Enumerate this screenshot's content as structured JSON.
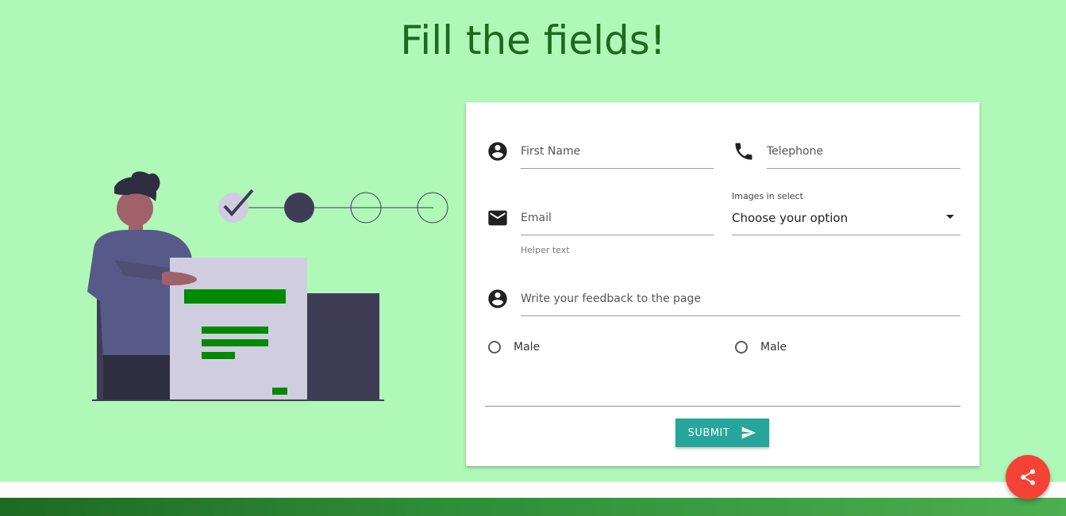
{
  "page": {
    "title": "Fill the fields!"
  },
  "form": {
    "first_name": {
      "placeholder": "First Name",
      "value": ""
    },
    "telephone": {
      "placeholder": "Telephone",
      "value": ""
    },
    "email": {
      "placeholder": "Email",
      "value": "",
      "helper": "Helper text"
    },
    "select": {
      "label": "Images in select",
      "value": "Choose your option"
    },
    "feedback": {
      "placeholder": "Write your feedback to the page",
      "value": ""
    },
    "radios": [
      {
        "label": "Male",
        "checked": false
      },
      {
        "label": "Male",
        "checked": false
      }
    ],
    "submit_label": "SUBMIT"
  },
  "icons": {
    "first_name": "account-circle-icon",
    "telephone": "phone-icon",
    "email": "email-icon",
    "feedback": "account-circle-icon",
    "submit": "send-icon",
    "fab": "share-icon"
  },
  "colors": {
    "background": "#b0f8b8",
    "title": "#1d6a1f",
    "accent": "#26a69a",
    "fab": "#f44336",
    "illustration_green": "#008a00",
    "illustration_dark": "#3f3d56"
  }
}
